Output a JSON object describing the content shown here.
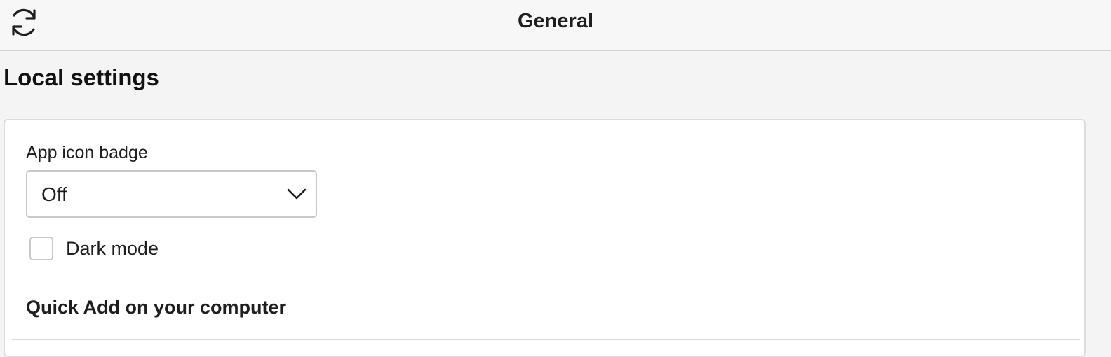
{
  "header": {
    "title": "General",
    "sync_icon": "sync-icon"
  },
  "section": {
    "title": "Local settings"
  },
  "settings": {
    "app_icon_badge": {
      "label": "App icon badge",
      "selected": "Off",
      "icon": "chevron-down-icon"
    },
    "dark_mode": {
      "label": "Dark mode",
      "checked": false
    },
    "quick_add": {
      "heading": "Quick Add on your computer"
    }
  },
  "colors": {
    "page_bg": "#f4f4f4",
    "card_bg": "#ffffff",
    "border": "#dcdcdc",
    "text": "#1e1e1e"
  }
}
